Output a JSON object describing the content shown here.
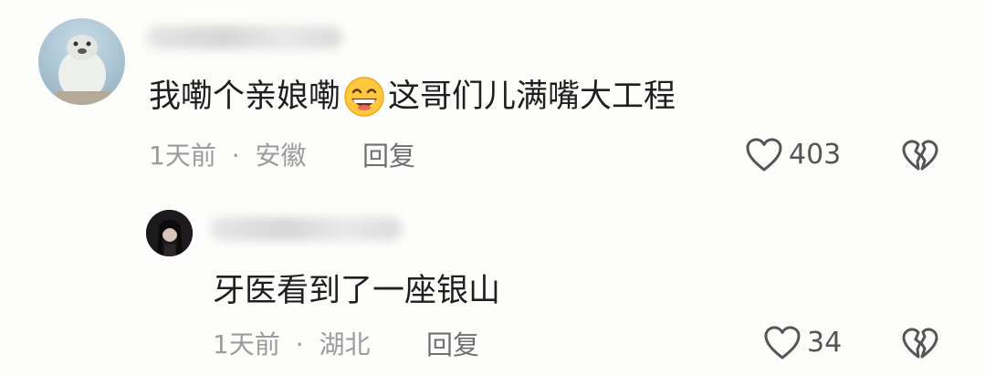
{
  "comments": [
    {
      "text_before_emoji": "我嘞个亲娘嘞",
      "emoji": "grinning-face-emoji",
      "text_after_emoji": "这哥们儿满嘴大工程",
      "time": "1天前",
      "separator": "·",
      "location": "安徽",
      "reply_label": "回复",
      "like_count": "403"
    },
    {
      "text": "牙医看到了一座银山",
      "time": "1天前",
      "separator": "·",
      "location": "湖北",
      "reply_label": "回复",
      "like_count": "34"
    }
  ],
  "icons": {
    "like": "heart-outline-icon",
    "dislike": "broken-heart-icon"
  },
  "colors": {
    "text": "#1f1f1f",
    "meta": "#9b9b9b",
    "icon": "#555555",
    "background": "#fdfdfb"
  }
}
